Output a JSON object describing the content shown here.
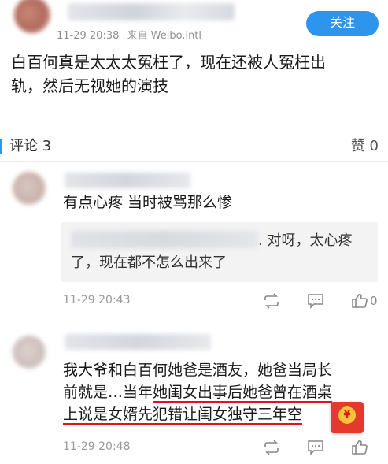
{
  "post": {
    "time": "11-29 20:38",
    "source": "来自 Weibo.intl",
    "follow_label": "关注",
    "text_line1": "白百何真是太太太冤枉了，现在还被人冤枉出",
    "text_line2": "轨，然后无视她的演技"
  },
  "tabs": {
    "comments_label": "评论 3",
    "likes_label": "赞 0"
  },
  "comments": [
    {
      "text": "有点心疼 当时被骂那么惨",
      "reply_line1_suffix": ". 对呀，太心疼",
      "reply_line2": "了，现在都不怎么出来了",
      "time": "11-29 20:43",
      "like_count": "0"
    },
    {
      "line1": "我大爷和白百何她爸是酒友，她爸当局长",
      "line2_plain": "前就是…当年",
      "line2_hl": "她闺女出事后她爸曾在酒桌",
      "line3": "上说是女婿先犯错让闺女独守三年空",
      "time": "11-29 20:48"
    }
  ],
  "icons": [
    "repost-icon",
    "comment-icon",
    "like-icon",
    "red-packet-icon"
  ],
  "colors": {
    "accent": "#2e95ef",
    "highlight": "#e0141e"
  }
}
